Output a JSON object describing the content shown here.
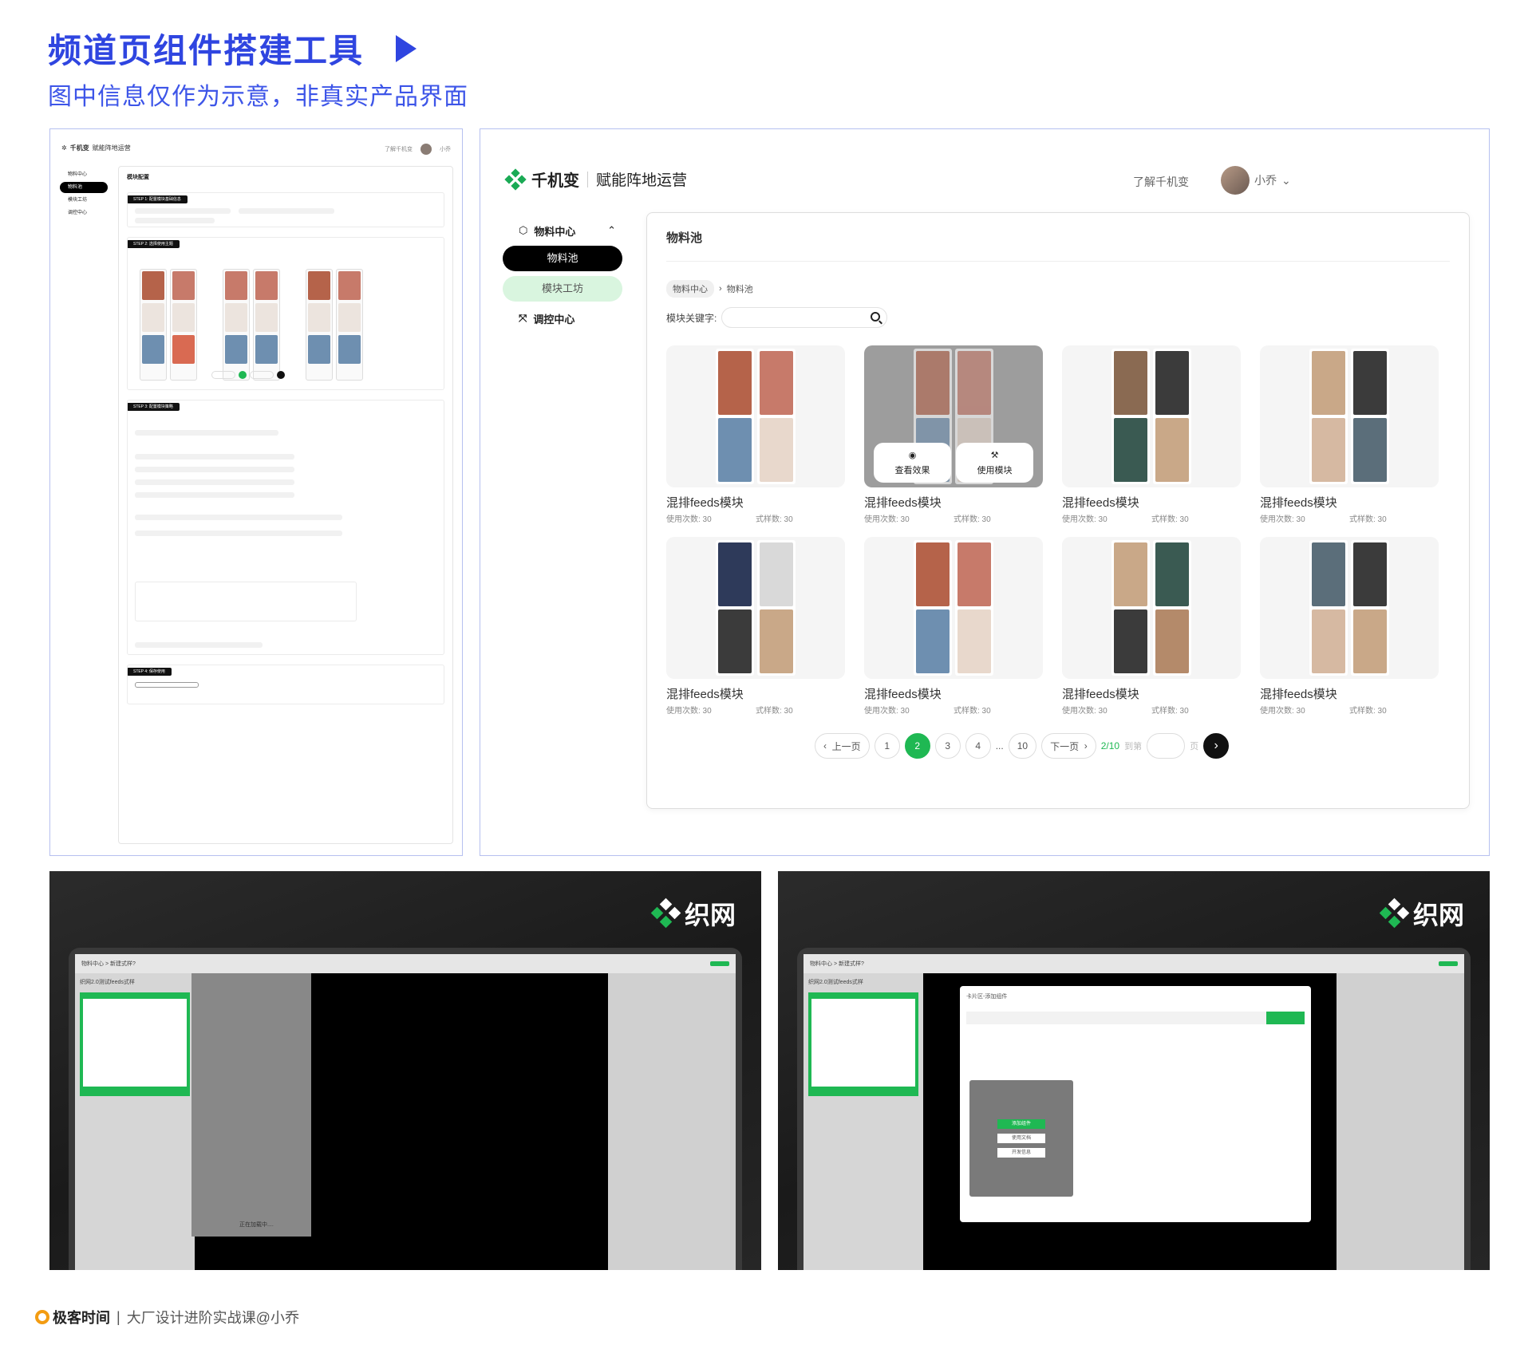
{
  "header": {
    "title": "频道页组件搭建工具",
    "subtitle": "图中信息仅作为示意，非真实产品界面"
  },
  "app": {
    "brand": "千机变",
    "tagline": "赋能阵地运营",
    "learn_more": "了解千机变",
    "user": "小乔"
  },
  "sidebar": {
    "group1": "物料中心",
    "item_pool": "物料池",
    "item_workshop": "模块工坊",
    "group2": "调控中心"
  },
  "pool": {
    "title": "物料池",
    "crumb_root": "物料中心",
    "crumb_current": "物料池",
    "search_label": "模块关键字:",
    "cards": [
      {
        "title": "混排feeds模块",
        "uses": "使用次数: 30",
        "styles": "式样数: 30"
      },
      {
        "title": "混排feeds模块",
        "uses": "使用次数: 30",
        "styles": "式样数: 30"
      },
      {
        "title": "混排feeds模块",
        "uses": "使用次数: 30",
        "styles": "式样数: 30"
      },
      {
        "title": "混排feeds模块",
        "uses": "使用次数: 30",
        "styles": "式样数: 30"
      },
      {
        "title": "混排feeds模块",
        "uses": "使用次数: 30",
        "styles": "式样数: 30"
      },
      {
        "title": "混排feeds模块",
        "uses": "使用次数: 30",
        "styles": "式样数: 30"
      },
      {
        "title": "混排feeds模块",
        "uses": "使用次数: 30",
        "styles": "式样数: 30"
      },
      {
        "title": "混排feeds模块",
        "uses": "使用次数: 30",
        "styles": "式样数: 30"
      }
    ],
    "hover_view": "查看效果",
    "hover_use": "使用模块"
  },
  "pager": {
    "prev": "上一页",
    "next": "下一页",
    "pages": [
      "1",
      "2",
      "3",
      "4",
      "...",
      "10"
    ],
    "current": "2",
    "info": "2/10",
    "goto": "到第",
    "page_unit": "页"
  },
  "p1": {
    "brand": "千机变",
    "tagline": "赋能阵地运营",
    "learn": "了解千机变",
    "user": "小乔",
    "nav": [
      "物料中心",
      "物料池",
      "模块工坊",
      "调控中心"
    ],
    "card_title": "模块配置",
    "step1": "STEP 1: 配置模块基础信息",
    "step2": "STEP 2: 选择使用主题",
    "step3": "STEP 3: 配置模块策略",
    "step4": "STEP 4: 保存使用"
  },
  "dark": {
    "brand": "织网",
    "crumb": "物料中心 > 新建式样?",
    "doc_title": "织网2.0测试feeds式样",
    "loading": "正在加载中....",
    "modal_title": "卡片区-添加组件",
    "add_btn": "添加组件",
    "doc_btn": "使用文档",
    "dev_btn": "开发信息"
  },
  "footer": {
    "brand": "极客时间",
    "course": "大厂设计进阶实战课@小乔"
  },
  "colors": {
    "accent": "#2f45e0",
    "green": "#1fb853"
  }
}
